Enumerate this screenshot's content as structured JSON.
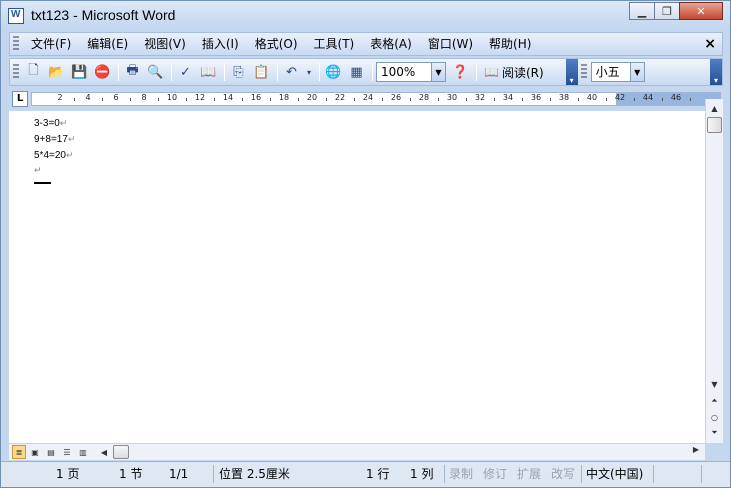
{
  "window": {
    "title": "txt123 - Microsoft Word"
  },
  "menu": {
    "items": [
      "文件(F)",
      "编辑(E)",
      "视图(V)",
      "插入(I)",
      "格式(O)",
      "工具(T)",
      "表格(A)",
      "窗口(W)",
      "帮助(H)"
    ]
  },
  "toolbar": {
    "zoom": "100%",
    "read_label": "阅读(R)",
    "font_size": "小五"
  },
  "ruler": {
    "numbers": [
      "2",
      "4",
      "6",
      "8",
      "10",
      "12",
      "14",
      "16",
      "18",
      "20",
      "22",
      "24",
      "26",
      "28",
      "30",
      "32",
      "34",
      "36",
      "38",
      "40",
      "42",
      "44",
      "46"
    ]
  },
  "document": {
    "lines": [
      "3-3=0",
      "9+8=17",
      "5*4=20"
    ],
    "para_mark": "↵"
  },
  "status": {
    "page": "1 页",
    "section": "1 节",
    "pages": "1/1",
    "position": "位置 2.5厘米",
    "line": "1 行",
    "column": "1 列",
    "rec": "录制",
    "trk": "修订",
    "ext": "扩展",
    "ovr": "改写",
    "language": "中文(中国)"
  }
}
